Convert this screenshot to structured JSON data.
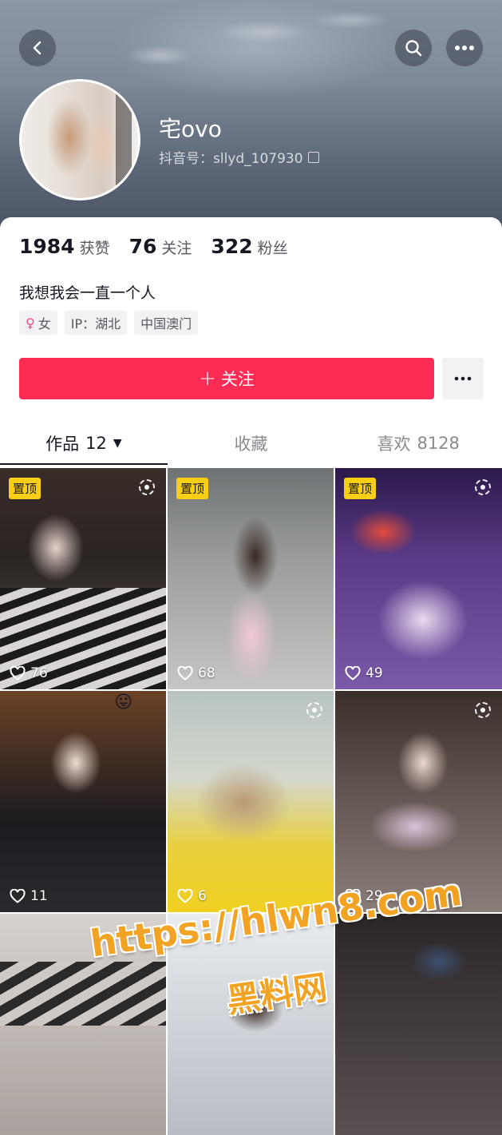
{
  "header": {
    "name": "宅ovo",
    "handle": "抖音号：sllyd_107930",
    "icons": {
      "back": "chevron-left-icon",
      "search": "search-icon",
      "more": "ellipsis-icon"
    }
  },
  "stats": [
    {
      "value": "1984",
      "label": "获赞"
    },
    {
      "value": "76",
      "label": "关注"
    },
    {
      "value": "322",
      "label": "粉丝"
    }
  ],
  "bio": "我想我会一直一个人",
  "tags": {
    "gender": "女",
    "ip": "IP：湖北",
    "location": "中国澳门"
  },
  "actions": {
    "follow_label": "关注",
    "follow_plus": "+"
  },
  "tabs": {
    "works_label": "作品",
    "works_count": "12",
    "favorites_label": "收藏",
    "likes_label": "喜欢",
    "likes_count": "8128"
  },
  "grid": {
    "pinned_label": "置顶",
    "items": [
      {
        "likes": "76",
        "pinned": true,
        "live": true
      },
      {
        "likes": "68",
        "pinned": true,
        "live": false
      },
      {
        "likes": "49",
        "pinned": true,
        "live": true
      },
      {
        "likes": "11",
        "pinned": false,
        "live": false,
        "emoji": "😛"
      },
      {
        "likes": "6",
        "pinned": false,
        "live": true
      },
      {
        "likes": "29",
        "pinned": false,
        "live": true
      }
    ]
  },
  "watermark": {
    "line1": "https://hlwn8.com",
    "line2": "黑料网"
  },
  "colors": {
    "accent": "#fe2c55",
    "pin": "#face15",
    "watermark": "#f2a323"
  }
}
